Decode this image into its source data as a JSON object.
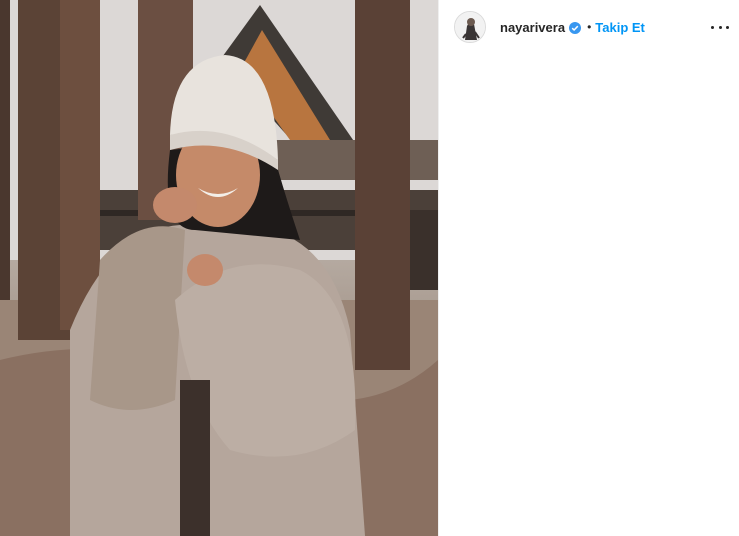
{
  "post": {
    "image_alt": "Woman in a white knit beanie and fluffy beige fur coat standing among pine trees in front of a wooden cabin"
  },
  "header": {
    "username": "nayarivera",
    "separator": "•",
    "follow_label": "Takip Et",
    "verified_icon": "verified-badge-icon",
    "more_icon": "more-options-icon"
  },
  "colors": {
    "link_blue": "#0095f6",
    "verified_blue": "#3897f0",
    "text_dark": "#262626"
  }
}
